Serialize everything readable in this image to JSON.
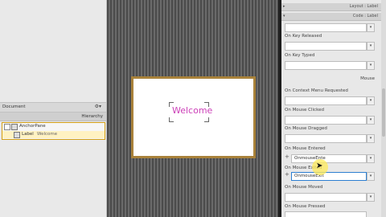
{
  "left": {
    "document_title": "Document",
    "hierarchy_title": "Hierarchy",
    "tree": [
      {
        "label": "AnchorPane",
        "sub": ""
      },
      {
        "label": "Label",
        "sub": "Welcome"
      }
    ]
  },
  "canvas": {
    "label_text": "Welcome"
  },
  "inspector": {
    "sections": [
      {
        "title": "Layout : Label"
      },
      {
        "title": "Code : Label"
      }
    ],
    "properties": [
      {
        "label": "",
        "value": ""
      },
      {
        "label": "On Key Released",
        "value": ""
      },
      {
        "label": "On Key Typed",
        "value": ""
      },
      {
        "label": "On Context Menu Requested",
        "value": ""
      },
      {
        "label": "On Mouse Clicked",
        "value": ""
      },
      {
        "label": "On Mouse Dragged",
        "value": ""
      },
      {
        "label": "On Mouse Entered",
        "value": "OnmouseEnte"
      },
      {
        "label": "On Mouse Exited",
        "value": "OnmouseExit"
      },
      {
        "label": "On Mouse Moved",
        "value": ""
      },
      {
        "label": "On Mouse Pressed",
        "value": ""
      }
    ],
    "mouse_group_title": "Mouse"
  },
  "icons": {
    "gear": "gear-icon",
    "dropdown": "chevron-down-icon",
    "plus": "plus-icon"
  }
}
